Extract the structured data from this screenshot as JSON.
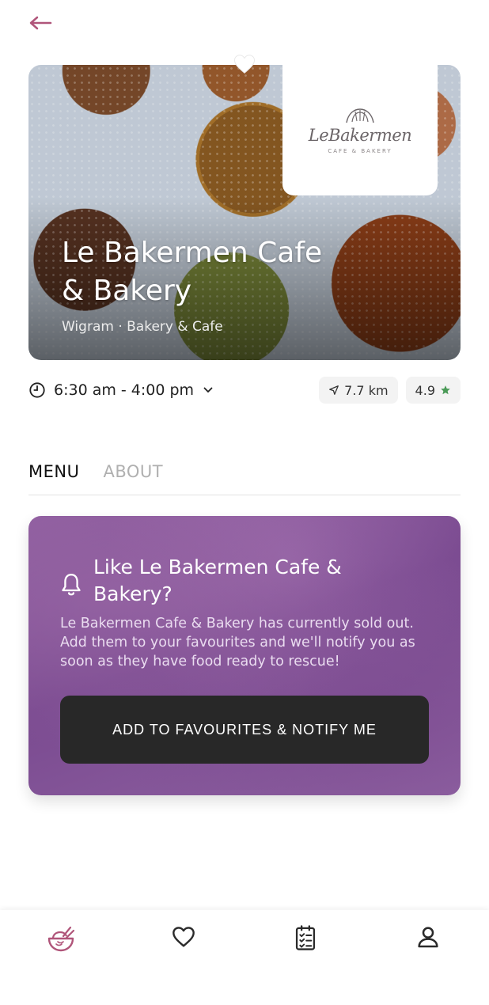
{
  "header": {
    "back_icon": "arrow-left-icon"
  },
  "store": {
    "name": "Le Bakermen Cafe & Bakery",
    "subtitle": "Wigram · Bakery & Cafe",
    "logo": {
      "wordmark": "LeBakermen",
      "tagline": "CAFE & BAKERY"
    },
    "hours": "6:30 am - 4:00 pm",
    "distance": "7.7 km",
    "rating": "4.9"
  },
  "tabs": [
    {
      "label": "MENU",
      "active": true
    },
    {
      "label": "ABOUT",
      "active": false
    }
  ],
  "promo": {
    "title": "Like Le Bakermen Cafe & Bakery?",
    "text": "Le Bakermen Cafe & Bakery has currently sold out. Add them to your favourites and we'll notify you as soon as they have food ready to rescue!",
    "button_label": "ADD TO FAVOURITES & NOTIFY ME"
  },
  "bottom_nav": [
    {
      "icon": "bowl-icon",
      "active": true
    },
    {
      "icon": "heart-icon",
      "active": false
    },
    {
      "icon": "clipboard-list-icon",
      "active": false
    },
    {
      "icon": "user-icon",
      "active": false
    }
  ],
  "colors": {
    "accent": "#b0557a",
    "promo_purple": "#7a4a90",
    "button_dark": "#282828"
  }
}
